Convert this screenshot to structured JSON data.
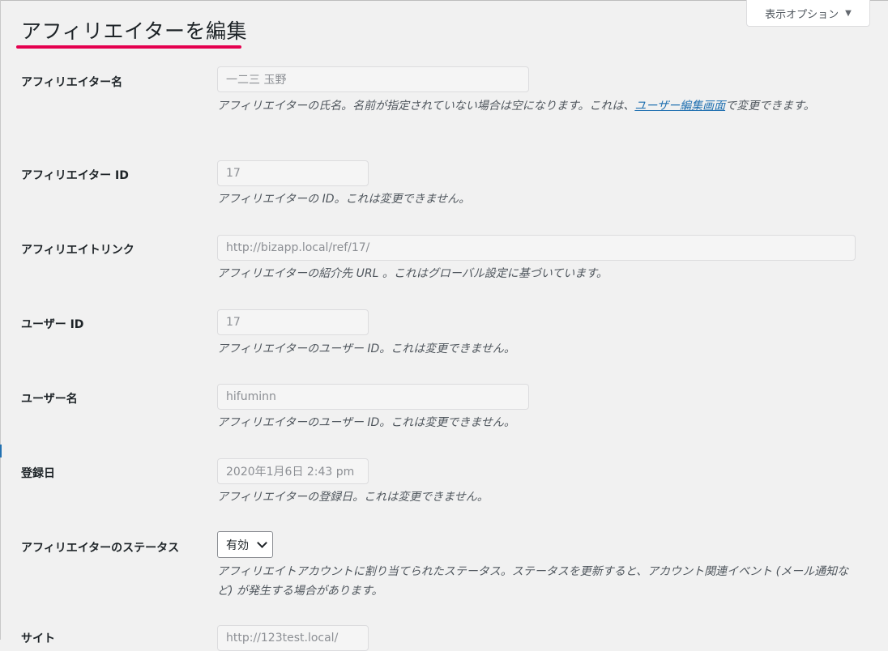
{
  "screen_options": {
    "label": "表示オプション",
    "arrow": "▼"
  },
  "page_title": "アフィリエイターを編集",
  "fields": {
    "name": {
      "label": "アフィリエイター名",
      "value": "一二三 玉野",
      "desc_before": "アフィリエイターの氏名。名前が指定されていない場合は空になります。これは、",
      "desc_link": "ユーザー編集画面",
      "desc_after": "で変更できます。"
    },
    "affiliate_id": {
      "label": "アフィリエイター ID",
      "value": "17",
      "desc": "アフィリエイターの ID。これは変更できません。"
    },
    "affiliate_link": {
      "label": "アフィリエイトリンク",
      "value": "http://bizapp.local/ref/17/",
      "desc": "アフィリエイターの紹介先 URL 。これはグローバル設定に基づいています。"
    },
    "user_id": {
      "label": "ユーザー ID",
      "value": "17",
      "desc": "アフィリエイターのユーザー ID。これは変更できません。"
    },
    "username": {
      "label": "ユーザー名",
      "value": "hifuminn",
      "desc": "アフィリエイターのユーザー ID。これは変更できません。"
    },
    "registered": {
      "label": "登録日",
      "value": "2020年1月6日 2:43 pm",
      "desc": "アフィリエイターの登録日。これは変更できません。"
    },
    "status": {
      "label": "アフィリエイターのステータス",
      "value": "有効",
      "desc": "アフィリエイトアカウントに割り当てられたステータス。ステータスを更新すると、アカウント関連イベント (メール通知など) が発生する場合があります。"
    },
    "site": {
      "label": "サイト",
      "value": "http://123test.local/"
    }
  },
  "colors": {
    "accent_underline": "#e5004f",
    "link": "#2271b1"
  }
}
